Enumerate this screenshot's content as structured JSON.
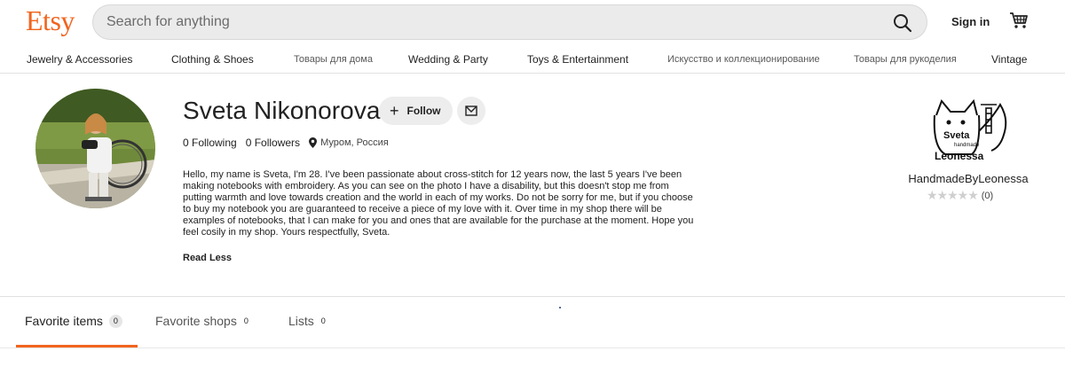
{
  "header": {
    "logo": "Etsy",
    "search_placeholder": "Search for anything",
    "signin_label": "Sign in",
    "icons": {
      "search": "search-icon",
      "cart": "cart-icon"
    }
  },
  "categories": [
    "Jewelry & Accessories",
    "Clothing & Shoes",
    "Товары для дома",
    "Wedding & Party",
    "Toys & Entertainment",
    "Искусство и коллекционирование",
    "Товары для рукоделия",
    "Vintage"
  ],
  "profile": {
    "name": "Sveta Nikonorova",
    "follow_label": "Follow",
    "following": "0 Following",
    "followers": "0 Followers",
    "location": "Муром, Россия",
    "bio": "Hello, my name is Sveta, I'm 28. I've been passionate about cross-stitch for 12 years now, the last 5 years I've been making notebooks with embroidery. As you can see on the photo I have a disability, but this doesn't stop me from putting warmth and love towards creation and the world in each of my works. Do not be sorry for me, but if you choose to buy my notebook you are guaranteed to receive a piece of my love with it. Over time in my shop there will be examples of notebooks, that I can make for you and ones that are available for the purchase at the moment. Hope you feel cosily in my shop. Yours respectfully, Sveta.",
    "read_less": "Read Less"
  },
  "shop": {
    "name": "HandmadeByLeonessa",
    "logo_text": [
      "Sveta",
      "handmade",
      "Leonessa"
    ],
    "rating_count": "(0)",
    "rating_value": 0,
    "rating_max": 5
  },
  "tabs": [
    {
      "label": "Favorite items",
      "count": "0",
      "active": true
    },
    {
      "label": "Favorite shops",
      "count": "0",
      "active": false
    },
    {
      "label": "Lists",
      "count": "0",
      "active": false
    }
  ],
  "colors": {
    "brand": "#F1641E",
    "search_bg": "#ebebeb",
    "button_bg": "#ededed"
  }
}
